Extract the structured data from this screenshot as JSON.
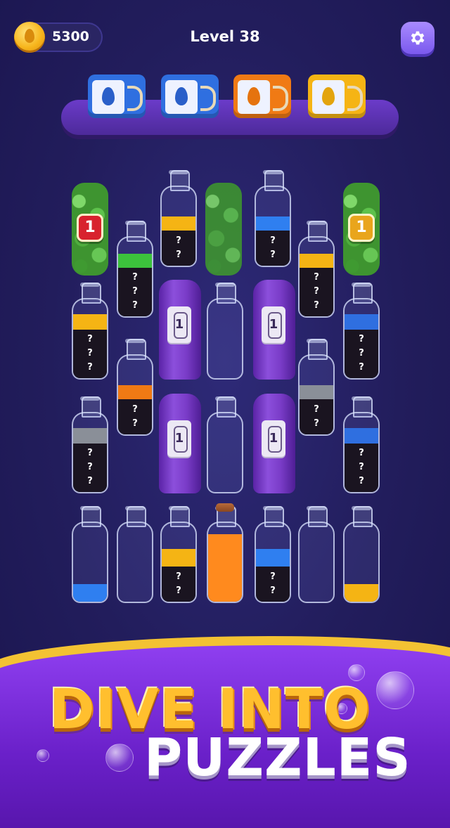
{
  "header": {
    "coins": "5300",
    "level_title": "Level 38",
    "settings_icon": "gear-icon",
    "coin_icon": "coin-drop-icon"
  },
  "color_boxes": [
    {
      "color": "#2f6fe0",
      "drop": "#2a5fc9"
    },
    {
      "color": "#2f6fe0",
      "drop": "#2a5fc9"
    },
    {
      "color": "#f07a14",
      "drop": "#e5730f"
    },
    {
      "color": "#f5b414",
      "drop": "#e3a40d"
    }
  ],
  "bottles": {
    "row1": [
      {
        "type": "leaf",
        "lock": "1",
        "badge_color": "#d8222e"
      },
      {
        "type": "bottle",
        "color": "#f5b414",
        "visible": 0.18,
        "hidden": 0.45,
        "q": [
          "?",
          "?"
        ]
      },
      {
        "type": "leaf-open"
      },
      {
        "type": "bottle",
        "color": "#2f7ff0",
        "visible": 0.18,
        "hidden": 0.45,
        "q": [
          "?",
          "?"
        ]
      },
      {
        "type": "leaf",
        "lock": "1",
        "badge_color": "#e9a51c"
      }
    ],
    "row2": [
      {
        "type": "bottle",
        "color": "#3cc23c",
        "visible": 0.18,
        "hidden": 0.62,
        "q": [
          "?",
          "?",
          "?"
        ]
      },
      {
        "type": "bottle",
        "color": "#f5b414",
        "visible": 0.18,
        "hidden": 0.62,
        "q": [
          "?",
          "?",
          "?"
        ]
      }
    ],
    "row3": [
      {
        "type": "bottle",
        "color": "#f5b414",
        "visible": 0.2,
        "hidden": 0.62,
        "q": [
          "?",
          "?",
          "?"
        ]
      },
      {
        "type": "cloth",
        "label": "1"
      },
      {
        "type": "bottle",
        "color": "",
        "visible": 0,
        "hidden": 0
      },
      {
        "type": "cloth",
        "label": "1"
      },
      {
        "type": "bottle",
        "color": "#2f6fe0",
        "visible": 0.2,
        "hidden": 0.62,
        "q": [
          "?",
          "?",
          "?"
        ]
      }
    ],
    "row4": [
      {
        "type": "bottle",
        "color": "#f07a14",
        "visible": 0.18,
        "hidden": 0.45,
        "q": [
          "?",
          "?"
        ]
      },
      {
        "type": "bottle",
        "color": "#8a8f98",
        "visible": 0.18,
        "hidden": 0.45,
        "q": [
          "?",
          "?"
        ]
      }
    ],
    "row5": [
      {
        "type": "bottle",
        "color": "#8a8f98",
        "visible": 0.2,
        "hidden": 0.62,
        "q": [
          "?",
          "?",
          "?"
        ]
      },
      {
        "type": "cloth",
        "label": "1"
      },
      {
        "type": "bottle",
        "color": "",
        "visible": 0,
        "hidden": 0
      },
      {
        "type": "cloth",
        "label": "1"
      },
      {
        "type": "bottle",
        "color": "#2f6fe0",
        "visible": 0.2,
        "hidden": 0.62,
        "q": [
          "?",
          "?",
          "?"
        ]
      }
    ],
    "row6": [
      {
        "type": "bottle",
        "color": "#2f7ff0",
        "visible": 0.22,
        "hidden": 0
      },
      {
        "type": "bottle",
        "color": "",
        "visible": 0,
        "hidden": 0
      },
      {
        "type": "bottle",
        "color": "#f5b414",
        "visible": 0.22,
        "hidden": 0.45,
        "q": [
          "?",
          "?"
        ]
      },
      {
        "type": "bottle",
        "color": "#ff8a1e",
        "visible": 0.86,
        "hidden": 0,
        "cork": true
      },
      {
        "type": "bottle",
        "color": "#2f7ff0",
        "visible": 0.22,
        "hidden": 0.45,
        "q": [
          "?",
          "?"
        ]
      },
      {
        "type": "bottle",
        "color": "",
        "visible": 0,
        "hidden": 0
      },
      {
        "type": "bottle",
        "color": "#f5b414",
        "visible": 0.22,
        "hidden": 0
      }
    ]
  },
  "banner": {
    "line1": "DIVE INTO",
    "line2": "PUZZLES"
  }
}
